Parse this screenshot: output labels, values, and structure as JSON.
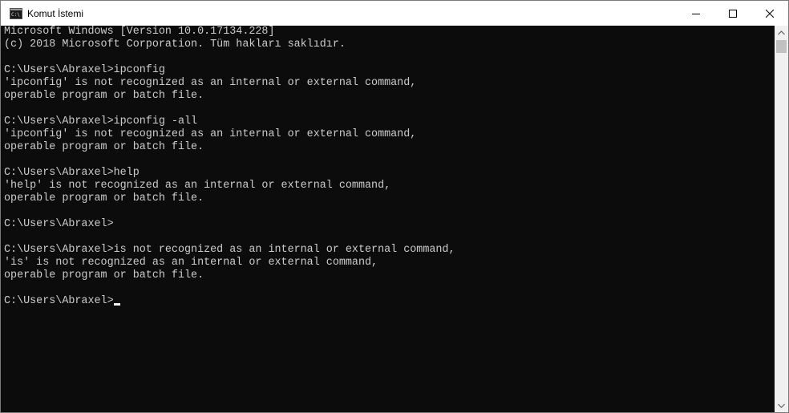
{
  "window": {
    "title": "Komut İstemi"
  },
  "console": {
    "lines": [
      "Microsoft Windows [Version 10.0.17134.228]",
      "(c) 2018 Microsoft Corporation. Tüm hakları saklıdır.",
      "",
      "C:\\Users\\Abraxel>ipconfig",
      "'ipconfig' is not recognized as an internal or external command,",
      "operable program or batch file.",
      "",
      "C:\\Users\\Abraxel>ipconfig -all",
      "'ipconfig' is not recognized as an internal or external command,",
      "operable program or batch file.",
      "",
      "C:\\Users\\Abraxel>help",
      "'help' is not recognized as an internal or external command,",
      "operable program or batch file.",
      "",
      "C:\\Users\\Abraxel>",
      "",
      "C:\\Users\\Abraxel>is not recognized as an internal or external command,",
      "'is' is not recognized as an internal or external command,",
      "operable program or batch file.",
      "",
      "C:\\Users\\Abraxel>"
    ]
  },
  "icons": {
    "app": "cmd-icon",
    "minimize": "minimize-icon",
    "maximize": "maximize-icon",
    "close": "close-icon",
    "scroll_up": "scroll-up-arrow-icon",
    "scroll_down": "scroll-down-arrow-icon"
  },
  "colors": {
    "console_background": "#0c0c0c",
    "console_text": "#cccccc",
    "titlebar": "#ffffff"
  }
}
